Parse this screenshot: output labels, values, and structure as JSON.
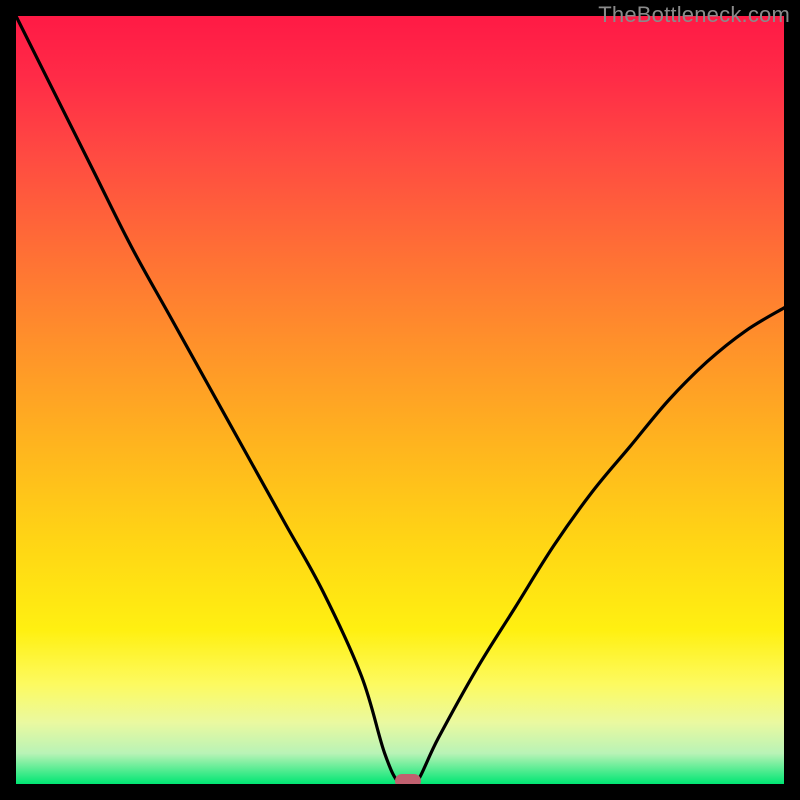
{
  "watermark": "TheBottleneck.com",
  "colors": {
    "frame": "#000000",
    "curve": "#000000",
    "marker": "#c1606f",
    "gradient_top": "#ff1a45",
    "gradient_bottom": "#00e673"
  },
  "chart_data": {
    "type": "line",
    "title": "",
    "xlabel": "",
    "ylabel": "",
    "xlim": [
      0,
      100
    ],
    "ylim": [
      0,
      100
    ],
    "grid": false,
    "legend": false,
    "x": [
      0,
      5,
      10,
      15,
      20,
      25,
      30,
      35,
      40,
      45,
      48,
      50,
      52,
      55,
      60,
      65,
      70,
      75,
      80,
      85,
      90,
      95,
      100
    ],
    "values": [
      100,
      90,
      80,
      70,
      61,
      52,
      43,
      34,
      25,
      14,
      4,
      0,
      0,
      6,
      15,
      23,
      31,
      38,
      44,
      50,
      55,
      59,
      62
    ],
    "flat_bottom": {
      "x_from": 48,
      "x_to": 52,
      "y": 0
    },
    "marker": {
      "x": 51,
      "y": 0
    },
    "annotations": []
  }
}
